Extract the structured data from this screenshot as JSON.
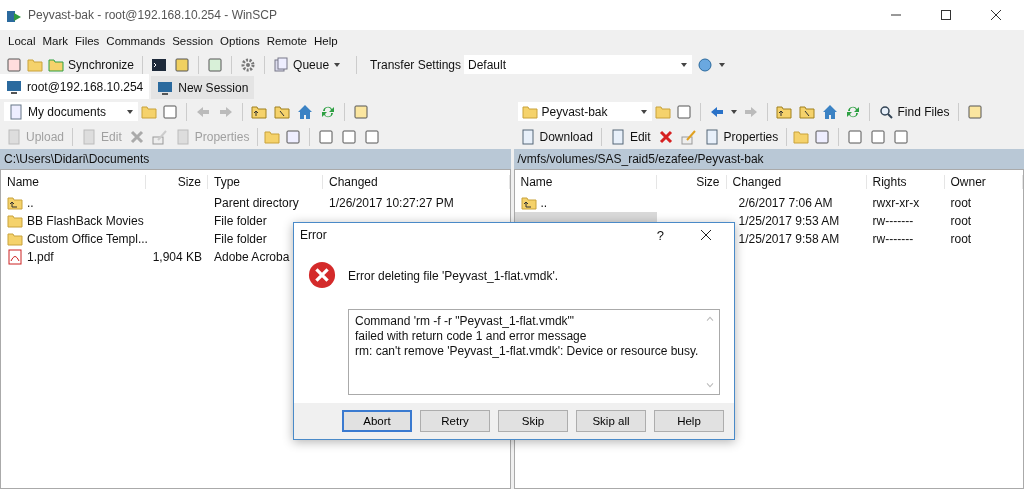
{
  "window": {
    "title": "Peyvast-bak - root@192.168.10.254 - WinSCP"
  },
  "menu": [
    "Local",
    "Mark",
    "Files",
    "Commands",
    "Session",
    "Options",
    "Remote",
    "Help"
  ],
  "toolbar": {
    "synchronize": "Synchronize",
    "queue": "Queue",
    "transfer_label": "Transfer Settings",
    "transfer_value": "Default"
  },
  "tabs": [
    {
      "label": "root@192.168.10.254",
      "selected": true
    },
    {
      "label": "New Session",
      "selected": false
    }
  ],
  "local": {
    "location": "My documents",
    "actions": [
      {
        "label": "Upload",
        "disabled": true
      },
      {
        "label": "Edit",
        "disabled": true
      },
      {
        "label": "Properties",
        "disabled": true
      }
    ],
    "path": "C:\\Users\\Didari\\Documents",
    "columns": [
      "Name",
      "Size",
      "Type",
      "Changed"
    ],
    "rows": [
      {
        "kind": "parent",
        "name": "..",
        "type": "Parent directory",
        "changed": "1/26/2017  10:27:27 PM"
      },
      {
        "kind": "folder",
        "name": "BB FlashBack Movies",
        "type": "File folder"
      },
      {
        "kind": "folder",
        "name": "Custom Office Templ...",
        "type": "File folder"
      },
      {
        "kind": "pdf",
        "name": "1.pdf",
        "size": "1,904 KB",
        "type": "Adobe Acroba"
      }
    ]
  },
  "remote": {
    "location": "Peyvast-bak",
    "find": "Find Files",
    "actions": [
      {
        "label": "Download",
        "disabled": false
      },
      {
        "label": "Edit",
        "disabled": false
      },
      {
        "label": "Properties",
        "disabled": false
      }
    ],
    "path": "/vmfs/volumes/SAS_raid5/ezafee/Peyvast-bak",
    "columns": [
      "Name",
      "Size",
      "Changed",
      "Rights",
      "Owner"
    ],
    "rows": [
      {
        "kind": "parent",
        "name": "..",
        "changed": "2/6/2017 7:06 AM",
        "rights": "rwxr-xr-x",
        "owner": "root",
        "selected": false
      },
      {
        "kind": "hidden",
        "changed": "1/25/2017 9:53 AM",
        "rights": "rw-------",
        "owner": "root",
        "selected": true
      },
      {
        "kind": "hidden",
        "changed": "1/25/2017 9:58 AM",
        "rights": "rw-------",
        "owner": "root"
      }
    ]
  },
  "dialog": {
    "title": "Error",
    "help": "?",
    "message": "Error deleting file 'Peyvast_1-flat.vmdk'.",
    "details": [
      "Command 'rm -f -r \"Peyvast_1-flat.vmdk\"'",
      "failed with return code 1 and error message",
      "rm: can't remove 'Peyvast_1-flat.vmdk': Device or resource busy."
    ],
    "buttons": [
      {
        "label": "Abort",
        "default": true
      },
      {
        "label": "Retry",
        "default": false
      },
      {
        "label": "Skip",
        "default": false
      },
      {
        "label": "Skip all",
        "default": false
      },
      {
        "label": "Help",
        "default": false
      }
    ]
  }
}
